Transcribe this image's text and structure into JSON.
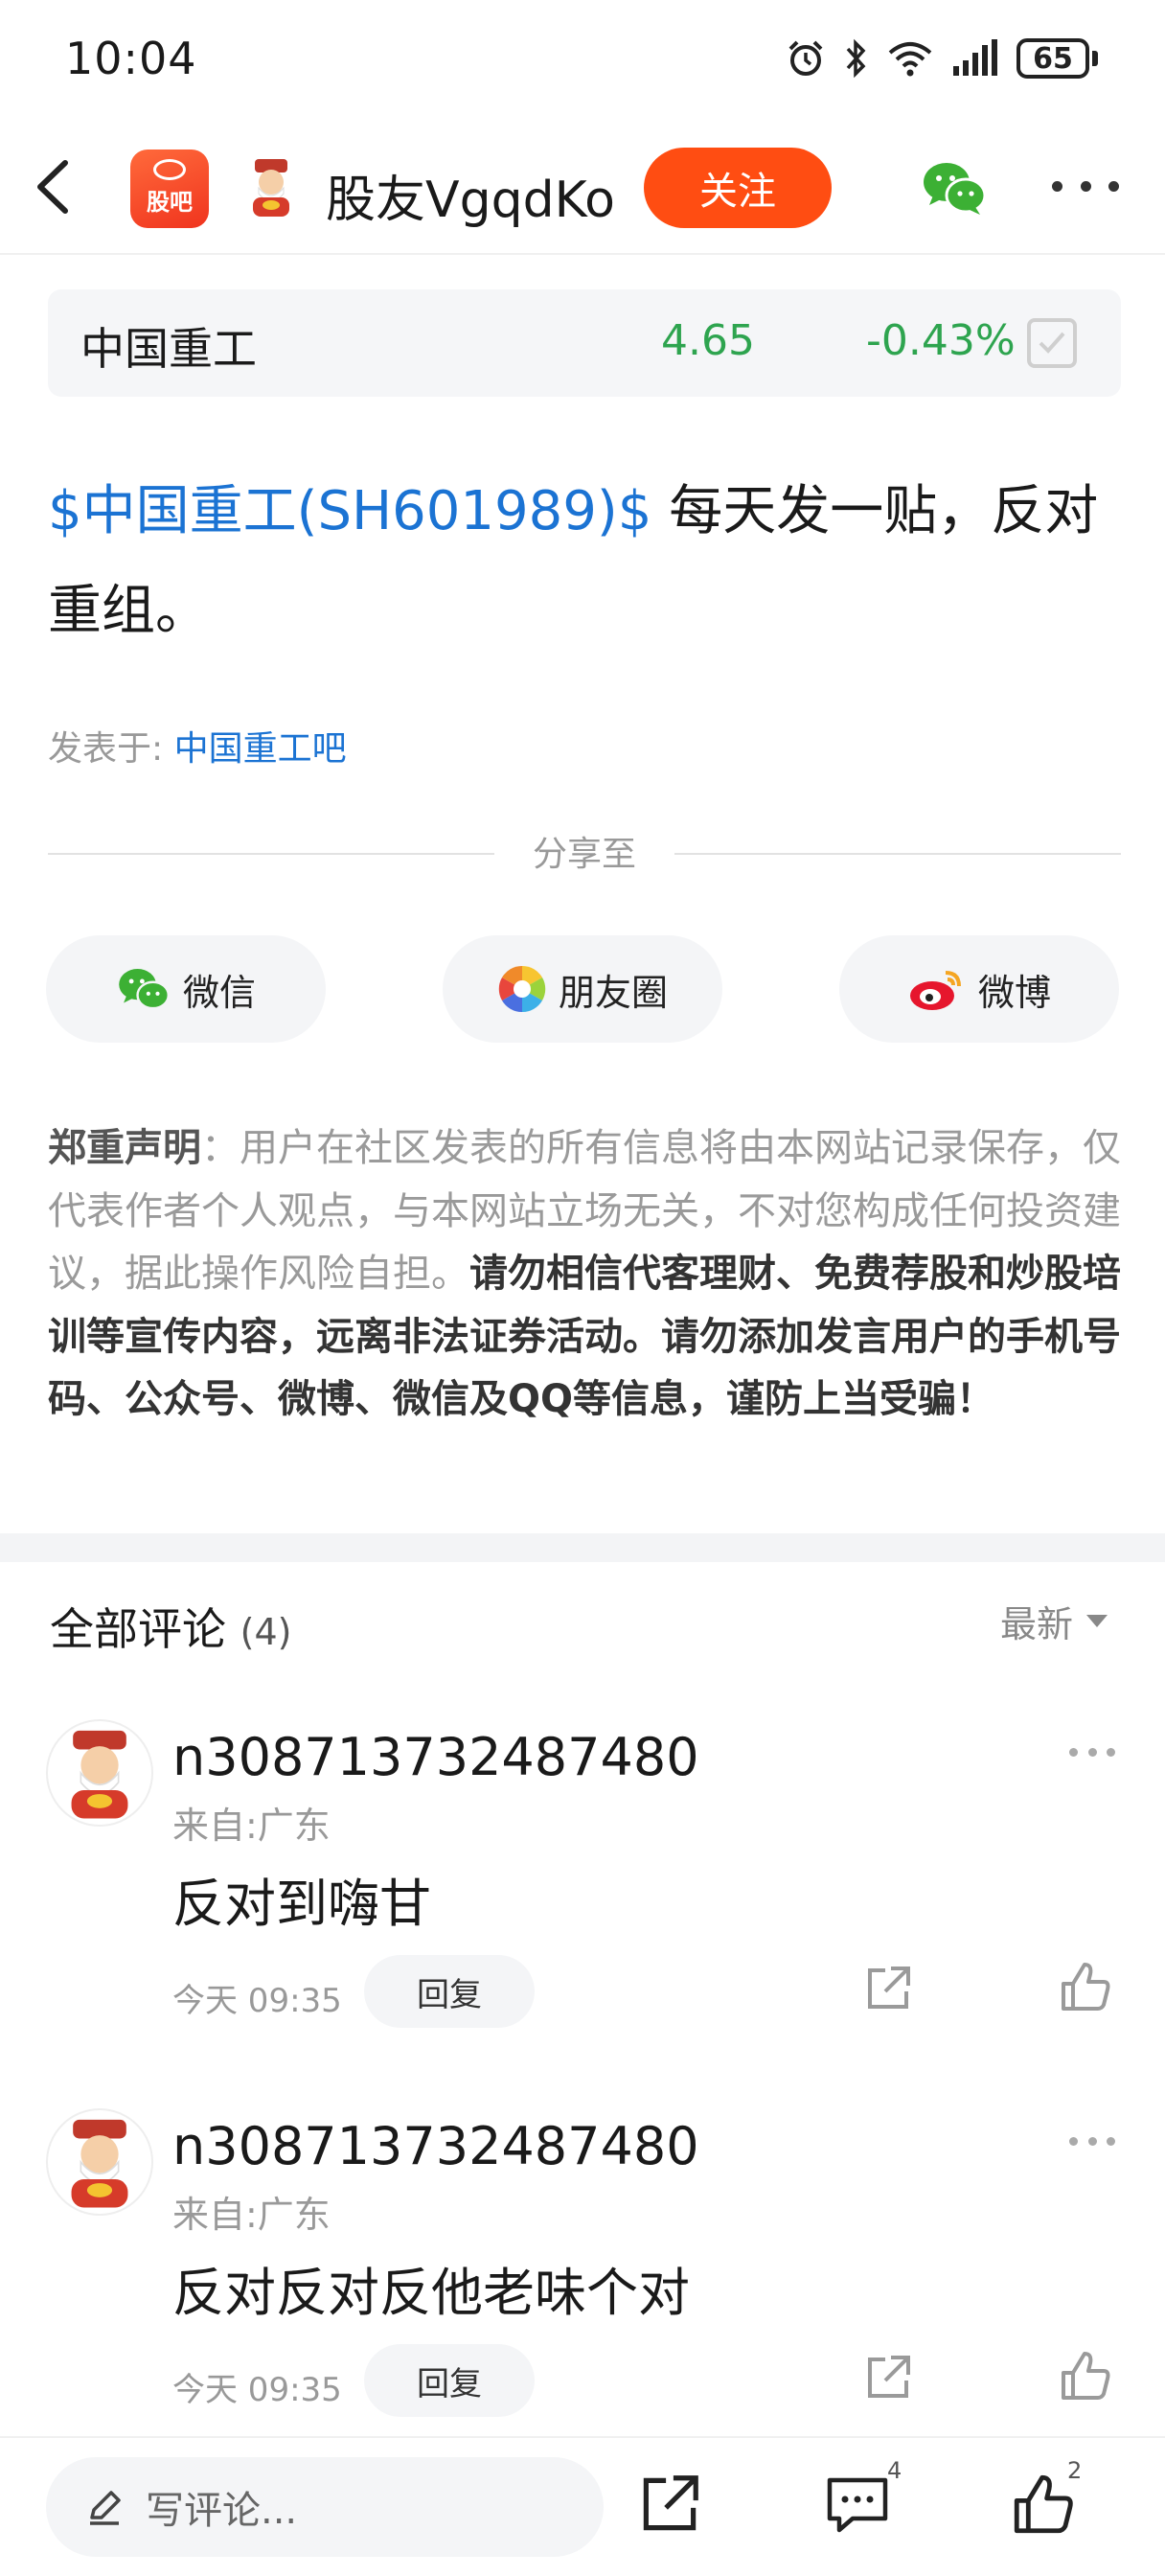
{
  "status_bar": {
    "time": "10:04",
    "battery": "65"
  },
  "nav": {
    "app_logo_label": "股吧",
    "username": "股友VgqdKo",
    "follow_label": "关注"
  },
  "stock": {
    "name": "中国重工",
    "price": "4.65",
    "change": "-0.43%",
    "change_color": "#2ea44f"
  },
  "post": {
    "tag_text": "$中国重工(SH601989)$",
    "body_text": " 每天发一贴，反对重组。",
    "posted_in_label": "发表于:",
    "posted_in_bar": "中国重工吧"
  },
  "share": {
    "label": "分享至",
    "buttons": [
      {
        "label": "微信",
        "icon": "wechat-icon"
      },
      {
        "label": "朋友圈",
        "icon": "moments-icon"
      },
      {
        "label": "微博",
        "icon": "weibo-icon"
      }
    ]
  },
  "disclaimer": {
    "title": "郑重声明",
    "normal_text": "：用户在社区发表的所有信息将由本网站记录保存，仅代表作者个人观点，与本网站立场无关，不对您构成任何投资建议，据此操作风险自担。",
    "warning_text": "请勿相信代客理财、免费荐股和炒股培训等宣传内容，远离非法证券活动。请勿添加发言用户的手机号码、公众号、微博、微信及QQ等信息，谨防上当受骗！"
  },
  "comments": {
    "title": "全部评论",
    "count": "(4)",
    "sort_label": "最新",
    "items": [
      {
        "user": "n308713732487480",
        "location": "来自:广东",
        "text": "反对到嗨甘",
        "time": "今天 09:35",
        "reply_label": "回复"
      },
      {
        "user": "n308713732487480",
        "location": "来自:广东",
        "text": "反对反对反他老味个对",
        "time": "今天 09:35",
        "reply_label": "回复"
      }
    ]
  },
  "bottom_bar": {
    "write_placeholder": "写评论...",
    "comment_count": "4",
    "like_count": "2"
  },
  "colors": {
    "accent": "#ff4d12",
    "link": "#1b73d3",
    "down": "#2ea44f"
  }
}
